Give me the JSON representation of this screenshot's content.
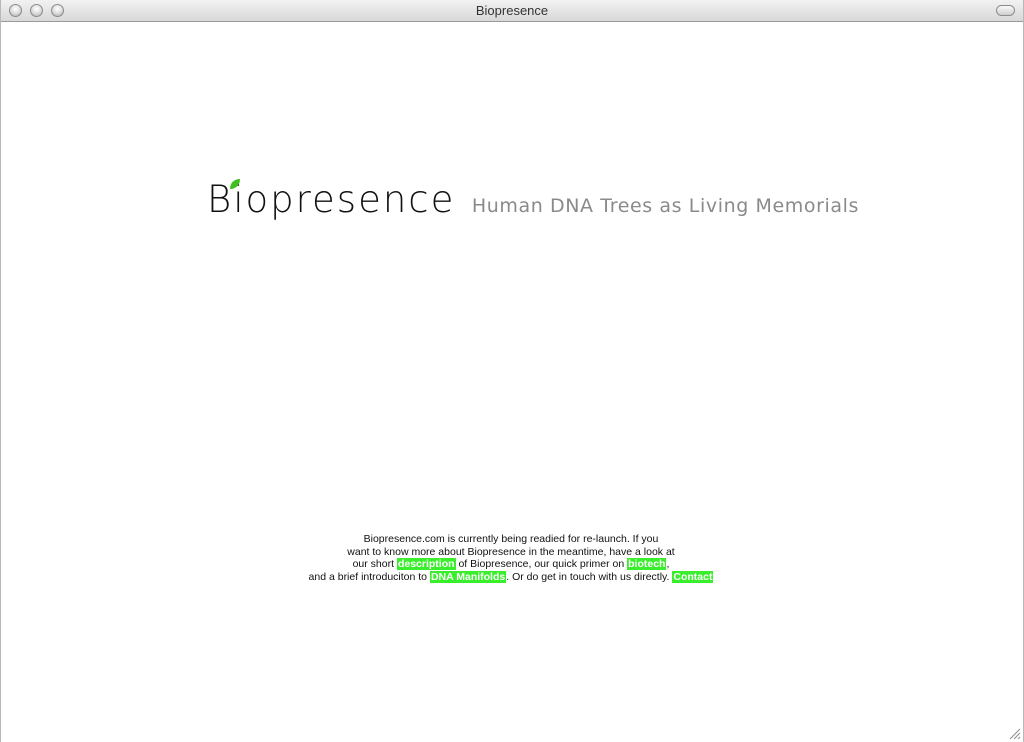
{
  "window": {
    "title": "Biopresence"
  },
  "header": {
    "logo_text": "Biopresence",
    "tagline": "Human DNA Trees as Living Memorials"
  },
  "intro": {
    "line1": "Biopresence.com is currently being readied for re-launch. If you",
    "line2": "want to know more about Biopresence in the meantime, have a look at",
    "line3_a": "our short ",
    "link_description": "description",
    "line3_b": " of Biopresence, our quick primer on ",
    "link_biotech": "biotech",
    "line3_c": ",",
    "line4_a": "and a brief introduciton to ",
    "link_dna_manifolds": "DNA Manifolds",
    "line4_b": ". Or do get in touch with us directly. ",
    "link_contact": "Contact"
  },
  "colors": {
    "link_highlight": "#39ef2c",
    "leaf": "#3fbf1f",
    "tagline": "#8a8a8a"
  },
  "icons": {
    "leaf": "leaf-icon",
    "resize": "resize-grip-icon"
  }
}
